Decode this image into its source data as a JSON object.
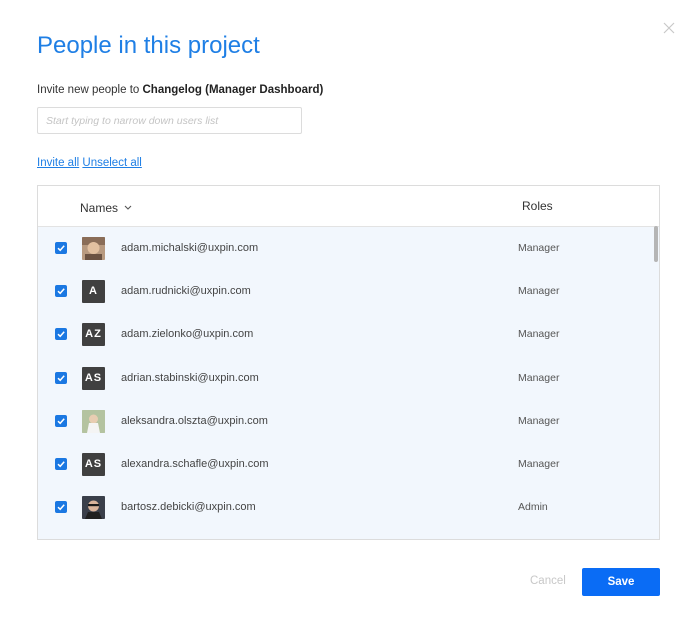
{
  "dialog": {
    "title": "People in this project",
    "invite_prefix": "Invite new people to ",
    "project_name": "Changelog (Manager Dashboard)",
    "close_icon": "close-icon"
  },
  "search": {
    "placeholder": "Start typing to narrow down users list",
    "value": ""
  },
  "bulk": {
    "invite_all": "Invite all",
    "unselect_all": "Unselect all"
  },
  "table": {
    "col_names": "Names",
    "col_roles": "Roles",
    "rows": [
      {
        "email": "adam.michalski@uxpin.com",
        "role": "Manager",
        "checked": true,
        "avatar": "photo",
        "initials": ""
      },
      {
        "email": "adam.rudnicki@uxpin.com",
        "role": "Manager",
        "checked": true,
        "avatar": "initials",
        "initials": "A"
      },
      {
        "email": "adam.zielonko@uxpin.com",
        "role": "Manager",
        "checked": true,
        "avatar": "initials",
        "initials": "AZ"
      },
      {
        "email": "adrian.stabinski@uxpin.com",
        "role": "Manager",
        "checked": true,
        "avatar": "initials",
        "initials": "AS"
      },
      {
        "email": "aleksandra.olszta@uxpin.com",
        "role": "Manager",
        "checked": true,
        "avatar": "photo",
        "initials": ""
      },
      {
        "email": "alexandra.schafle@uxpin.com",
        "role": "Manager",
        "checked": true,
        "avatar": "initials",
        "initials": "AS"
      },
      {
        "email": "bartosz.debicki@uxpin.com",
        "role": "Admin",
        "checked": true,
        "avatar": "photo",
        "initials": ""
      }
    ]
  },
  "footer": {
    "cancel": "Cancel",
    "save": "Save"
  },
  "colors": {
    "accent": "#1f7fe5",
    "save_bg": "#0a6cf5",
    "table_bg": "#f2f7fd",
    "avatar_bg": "#404040"
  }
}
